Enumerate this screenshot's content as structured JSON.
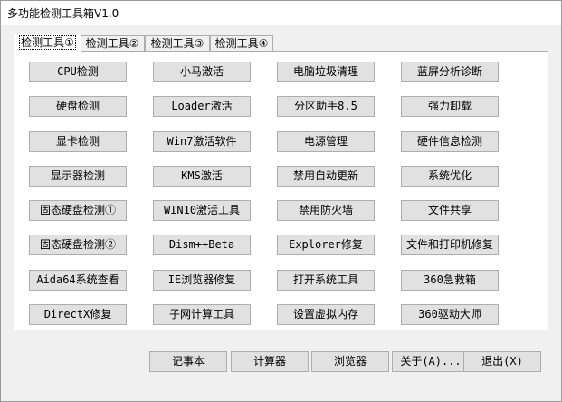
{
  "window": {
    "title": "多功能检测工具箱V1.0"
  },
  "tabs": [
    {
      "label": "检测工具①",
      "active": true
    },
    {
      "label": "检测工具②",
      "active": false
    },
    {
      "label": "检测工具③",
      "active": false
    },
    {
      "label": "检测工具④",
      "active": false
    }
  ],
  "tool_rows": [
    [
      "CPU检测",
      "小马激活",
      "电脑垃圾清理",
      "蓝屏分析诊断"
    ],
    [
      "硬盘检测",
      "Loader激活",
      "分区助手8.5",
      "强力卸载"
    ],
    [
      "显卡检测",
      "Win7激活软件",
      "电源管理",
      "硬件信息检测"
    ],
    [
      "显示器检测",
      "KMS激活",
      "禁用自动更新",
      "系统优化"
    ],
    [
      "固态硬盘检测①",
      "WIN10激活工具",
      "禁用防火墙",
      "文件共享"
    ],
    [
      "固态硬盘检测②",
      "Dism++Beta",
      "Explorer修复",
      "文件和打印机修复"
    ],
    [
      "Aida64系统查看",
      "IE浏览器修复",
      "打开系统工具",
      "360急救箱"
    ],
    [
      "DirectX修复",
      "子网计算工具",
      "设置虚拟内存",
      "360驱动大师"
    ]
  ],
  "bottom_buttons": [
    "记事本",
    "计算器",
    "浏览器",
    "关于(A)...",
    "退出(X)"
  ]
}
